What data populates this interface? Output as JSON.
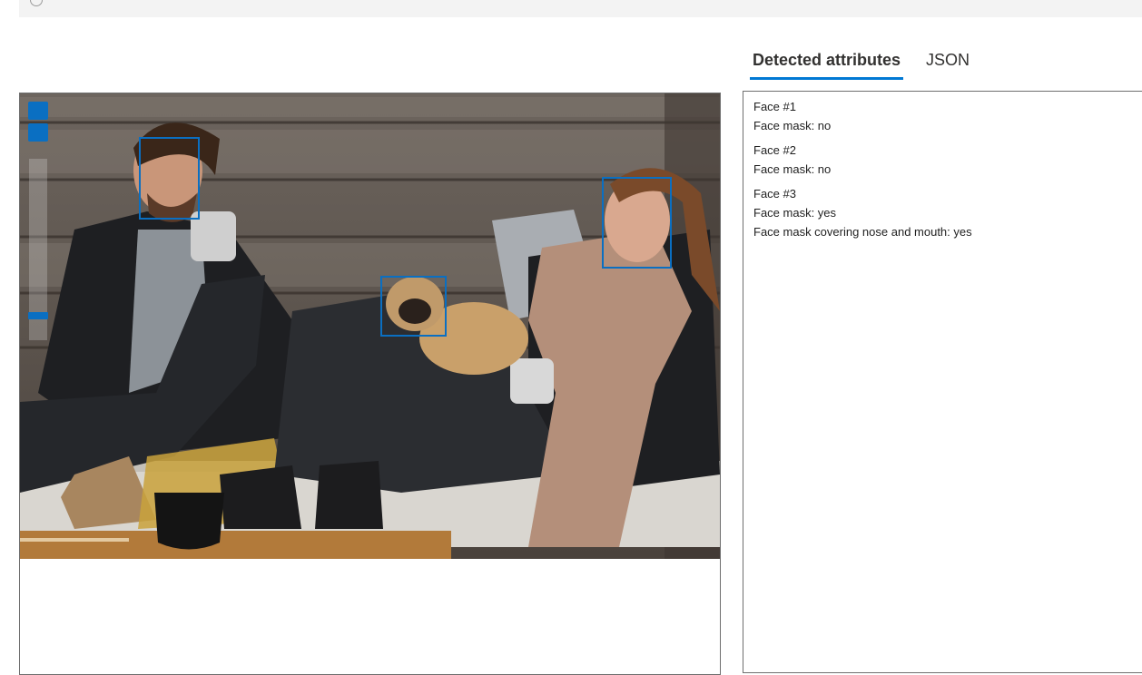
{
  "tabs": [
    {
      "label": "Detected attributes",
      "active": true
    },
    {
      "label": "JSON",
      "active": false
    }
  ],
  "viewer": {
    "zoom_in_icon": "plus-icon",
    "zoom_out_icon": "minus-icon",
    "zoom_level": 0.08,
    "faces": [
      {
        "id": "face-1"
      },
      {
        "id": "face-2"
      },
      {
        "id": "face-3"
      }
    ]
  },
  "results": {
    "faces": [
      {
        "title": "Face #1",
        "lines": [
          "Face mask: no"
        ]
      },
      {
        "title": "Face #2",
        "lines": [
          "Face mask: no"
        ]
      },
      {
        "title": "Face #3",
        "lines": [
          "Face mask: yes",
          "Face mask covering nose and mouth: yes"
        ]
      }
    ]
  },
  "colors": {
    "accent": "#0078d4",
    "box": "#0a6fc2",
    "border": "#6e6e6e"
  }
}
